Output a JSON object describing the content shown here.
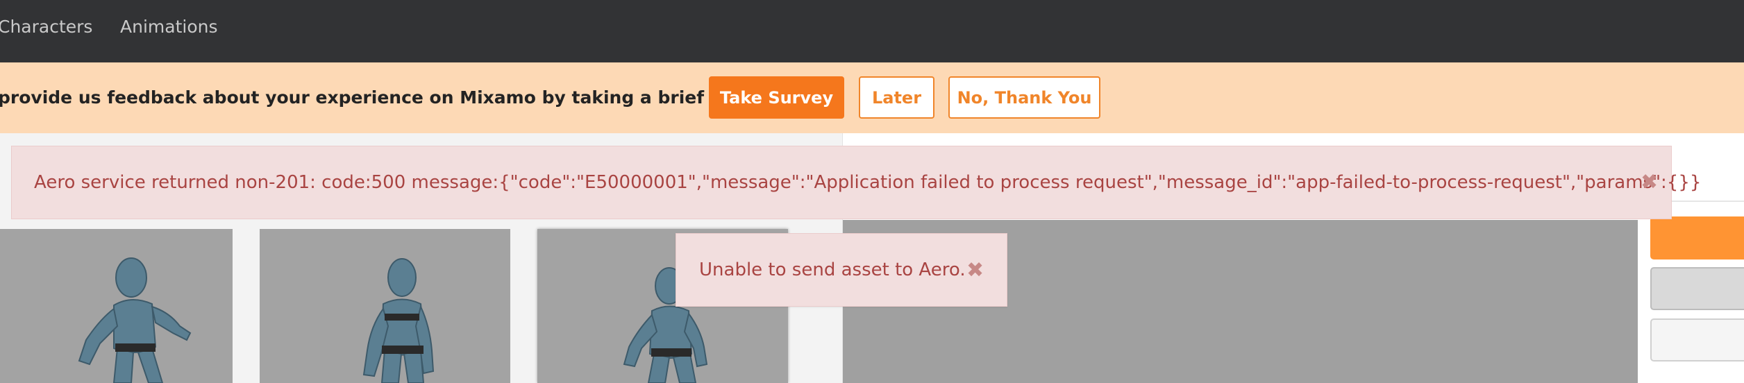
{
  "nav": {
    "items": [
      {
        "label": "Characters"
      },
      {
        "label": "Animations"
      }
    ]
  },
  "survey": {
    "prompt": "provide us feedback about your experience on Mixamo by taking a brief survey?",
    "take_survey": "Take Survey",
    "later": "Later",
    "no_thanks": "No, Thank You"
  },
  "alerts": {
    "aero_error": "Aero service returned non-201: code:500 message:{\"code\":\"E50000001\",\"message\":\"Application failed to process request\",\"message_id\":\"app-failed-to-process-request\",\"params\":{}}",
    "asset_error": "Unable to send asset to Aero.",
    "close_glyph": "✖"
  },
  "colors": {
    "nav_bg": "#323335",
    "survey_bg": "#fdd9b5",
    "accent_orange": "#f5771c",
    "alert_bg": "#f2dede",
    "alert_text": "#a94442"
  },
  "icons": {
    "close": "close-icon"
  }
}
